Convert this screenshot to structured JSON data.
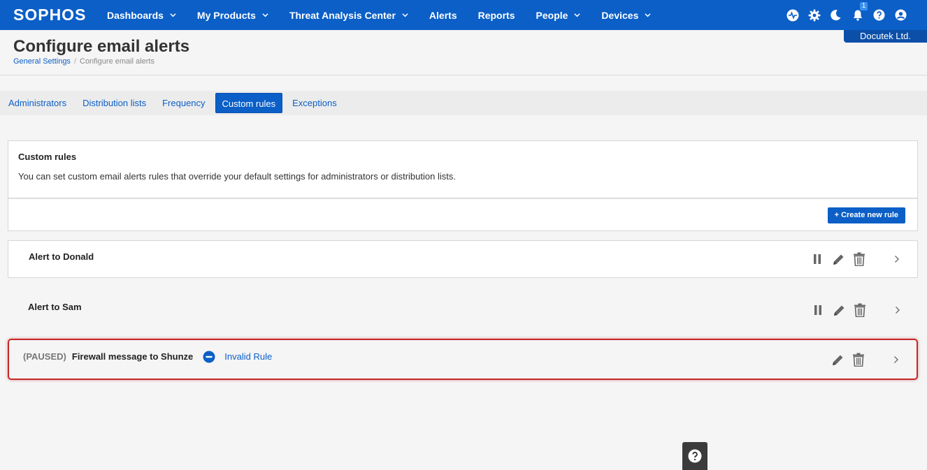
{
  "brand": {
    "logo_text": "SOPHOS",
    "accent": "#0b5fc7"
  },
  "nav": {
    "items": [
      {
        "label": "Dashboards",
        "dropdown": true
      },
      {
        "label": "My Products",
        "dropdown": true
      },
      {
        "label": "Threat Analysis Center",
        "dropdown": true
      },
      {
        "label": "Alerts",
        "dropdown": false
      },
      {
        "label": "Reports",
        "dropdown": false
      },
      {
        "label": "People",
        "dropdown": true
      },
      {
        "label": "Devices",
        "dropdown": true
      }
    ],
    "icons": [
      "health-icon",
      "gear-icon",
      "moon-icon",
      "bell-icon",
      "help-icon",
      "user-icon"
    ],
    "notification_count": "1",
    "tenant": "Docutek Ltd."
  },
  "header": {
    "title": "Configure email alerts",
    "breadcrumb": {
      "parent": "General Settings",
      "separator": "/",
      "current": "Configure email alerts"
    }
  },
  "tabs": [
    {
      "label": "Administrators",
      "active": false
    },
    {
      "label": "Distribution lists",
      "active": false
    },
    {
      "label": "Frequency",
      "active": false
    },
    {
      "label": "Custom rules",
      "active": true
    },
    {
      "label": "Exceptions",
      "active": false
    }
  ],
  "panel": {
    "title": "Custom rules",
    "description": "You can set custom email alerts rules that override your default settings for administrators or distribution lists.",
    "create_button": "+ Create new rule"
  },
  "rules": [
    {
      "name": "Alert to Donald",
      "status": "",
      "invalid_label": ""
    },
    {
      "name": "Alert to Sam",
      "status": "",
      "invalid_label": ""
    },
    {
      "name": "Firewall message to Shunze",
      "status": "(PAUSED)",
      "invalid_label": "Invalid Rule"
    }
  ],
  "status_colors": {
    "highlight_border": "#c62828",
    "invalid_icon": "#0b5fc7"
  }
}
